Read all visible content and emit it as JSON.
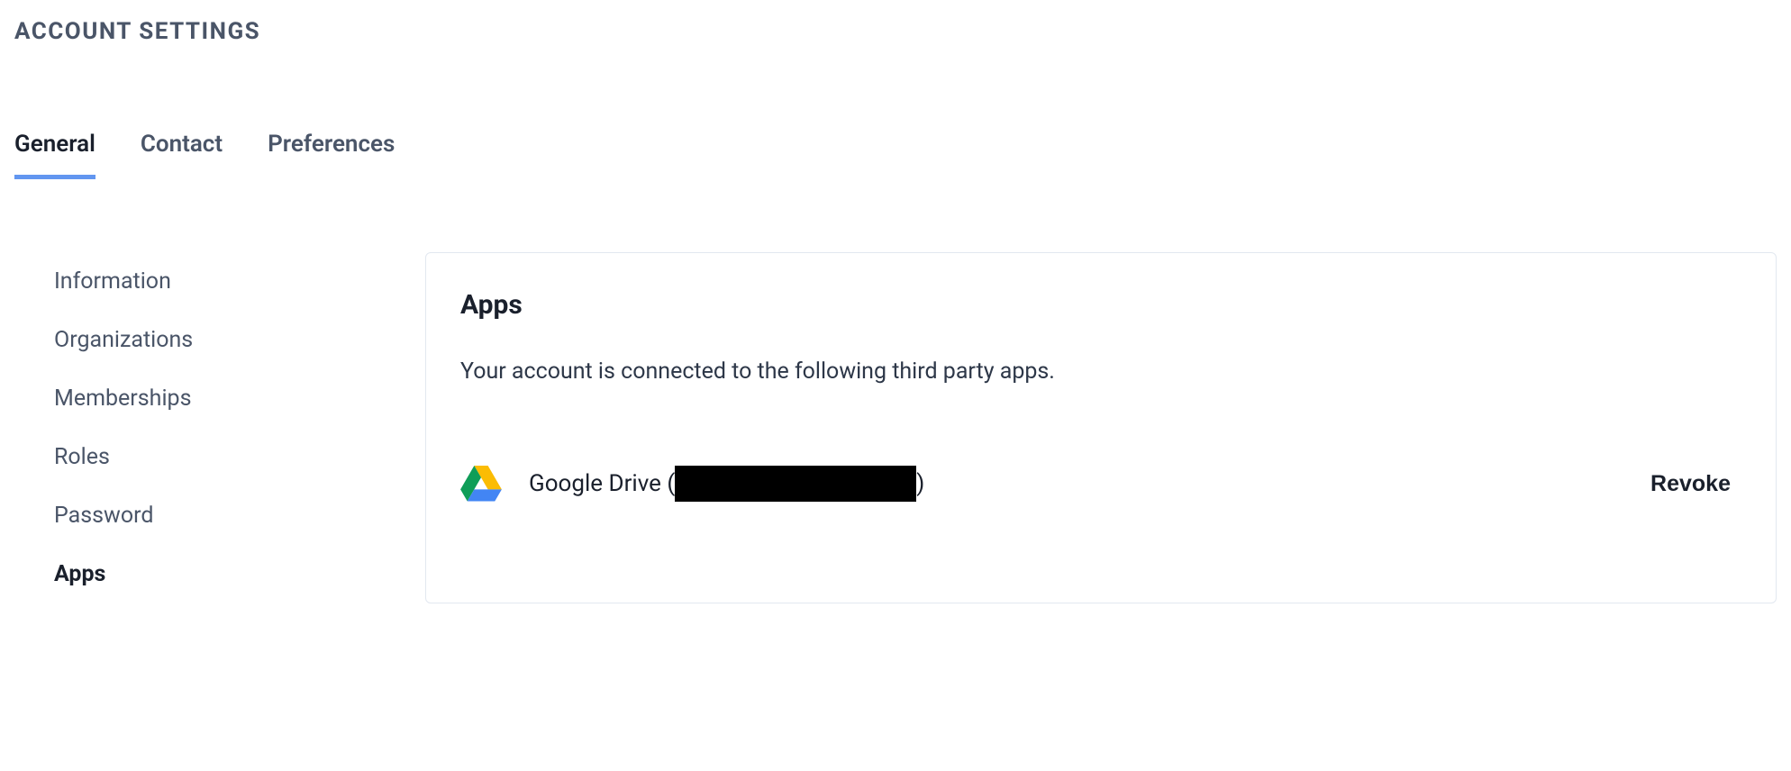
{
  "page_title": "ACCOUNT SETTINGS",
  "tabs": [
    {
      "label": "General",
      "active": true
    },
    {
      "label": "Contact",
      "active": false
    },
    {
      "label": "Preferences",
      "active": false
    }
  ],
  "sidebar": {
    "items": [
      {
        "label": "Information",
        "active": false
      },
      {
        "label": "Organizations",
        "active": false
      },
      {
        "label": "Memberships",
        "active": false
      },
      {
        "label": "Roles",
        "active": false
      },
      {
        "label": "Password",
        "active": false
      },
      {
        "label": "Apps",
        "active": true
      }
    ]
  },
  "panel": {
    "title": "Apps",
    "description": "Your account is connected to the following third party apps.",
    "apps": [
      {
        "name_prefix": "Google Drive (",
        "name_suffix": ")",
        "account_redacted": true,
        "revoke_label": "Revoke"
      }
    ]
  }
}
